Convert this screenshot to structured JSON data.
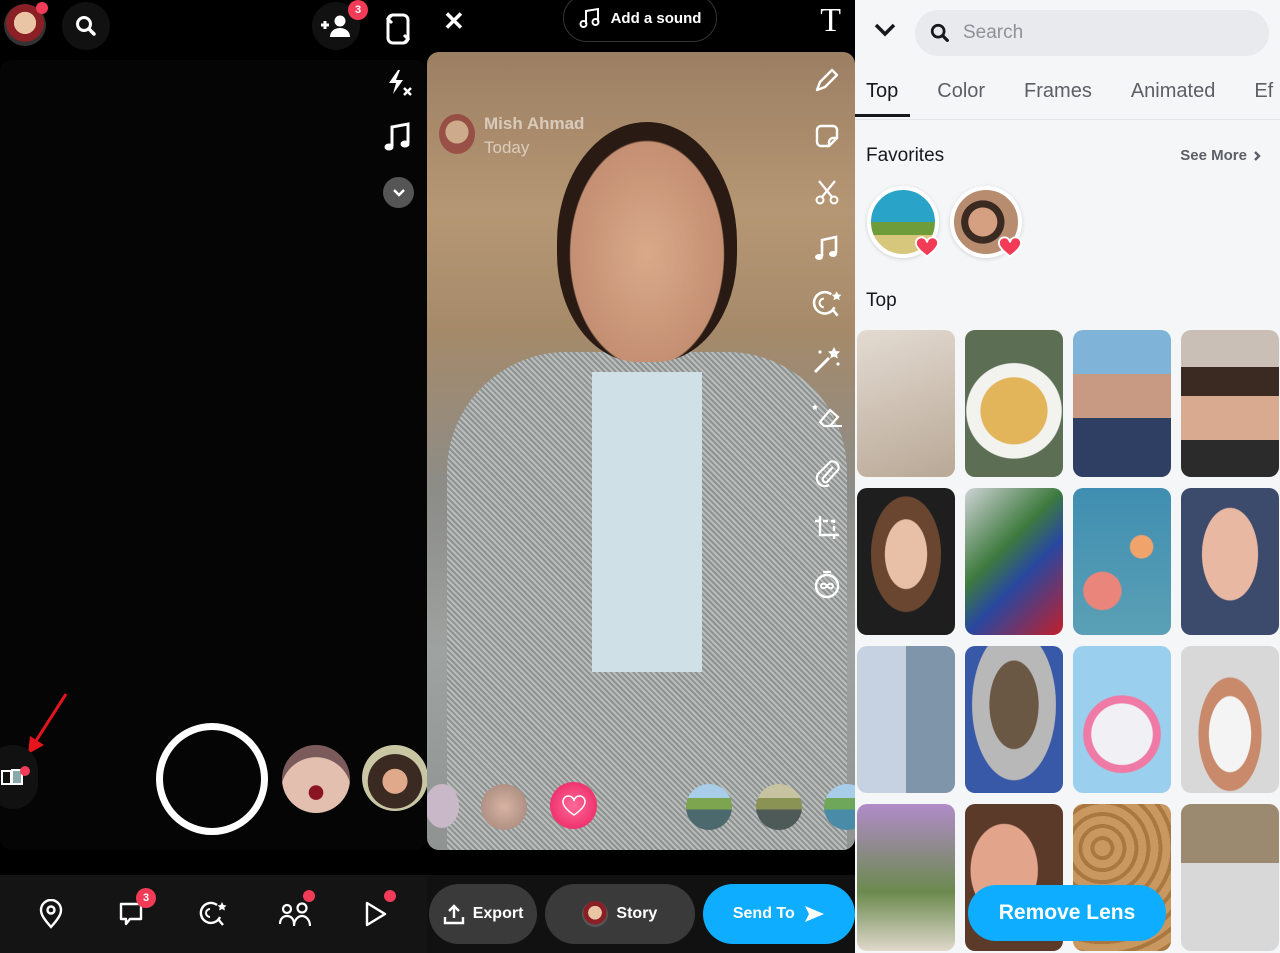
{
  "camera": {
    "friends_badge": "3",
    "nav": [
      {
        "name": "map",
        "icon": "map-pin-icon",
        "badge": null,
        "dot": false
      },
      {
        "name": "chat",
        "icon": "chat-icon",
        "badge": "3",
        "dot": false
      },
      {
        "name": "lenses",
        "icon": "lens-explore-icon",
        "badge": null,
        "dot": false
      },
      {
        "name": "stories",
        "icon": "friends-icon",
        "badge": null,
        "dot": true
      },
      {
        "name": "spotlight",
        "icon": "play-icon",
        "badge": null,
        "dot": true
      }
    ]
  },
  "editor": {
    "close_label": "✕",
    "sound_label": "Add a sound",
    "text_tool": "T",
    "overlay_name": "Mish Ahmad",
    "overlay_time": "Today",
    "tools": [
      "pencil-icon",
      "sticker-icon",
      "scissors-icon",
      "music-icon",
      "lens-icon",
      "magic-wand-icon",
      "eraser-icon",
      "paperclip-icon",
      "crop-icon",
      "timer-icon"
    ],
    "export_label": "Export",
    "story_label": "Story",
    "send_label": "Send To",
    "accent": "#0fadff"
  },
  "lenses": {
    "search_placeholder": "Search",
    "tabs": [
      "Top",
      "Color",
      "Frames",
      "Animated",
      "Ef"
    ],
    "active_tab": "Top",
    "favorites_title": "Favorites",
    "see_more": "See More",
    "top_title": "Top",
    "remove_label": "Remove Lens",
    "tiles": [
      {
        "name": "white-cat"
      },
      {
        "name": "noodles"
      },
      {
        "name": "puppy-face-girl"
      },
      {
        "name": "woman-portrait"
      },
      {
        "name": "woman-smile"
      },
      {
        "name": "snack-pile"
      },
      {
        "name": "butterfly-flowers"
      },
      {
        "name": "big-face-man"
      },
      {
        "name": "sky-collage"
      },
      {
        "name": "monkey-face"
      },
      {
        "name": "teddy-balloons"
      },
      {
        "name": "santa-beard"
      },
      {
        "name": "purple-flowers"
      },
      {
        "name": "red-lips"
      },
      {
        "name": "peanuts"
      },
      {
        "name": "cartoon-man"
      }
    ]
  }
}
